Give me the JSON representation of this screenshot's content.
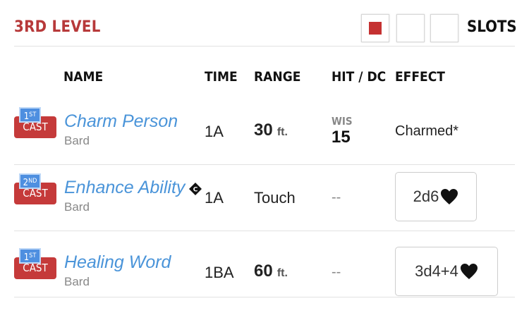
{
  "header": {
    "level_title": "3RD LEVEL",
    "slots_label": "SLOTS",
    "slot_states": [
      true,
      false,
      false
    ]
  },
  "columns": {
    "name": "NAME",
    "time": "TIME",
    "range": "RANGE",
    "hit_dc": "HIT / DC",
    "effect": "EFFECT"
  },
  "spells": [
    {
      "badge_num": "1",
      "badge_suffix": "ST",
      "cast_label": "CAST",
      "name": "Charm Person",
      "class": "Bard",
      "time": "1A",
      "range_value": "30",
      "range_unit": "ft.",
      "hit_dc_ability": "WIS",
      "hit_dc_value": "15",
      "effect": "Charmed*"
    },
    {
      "badge_num": "2",
      "badge_suffix": "ND",
      "cast_label": "CAST",
      "name": "Enhance Ability",
      "class": "Bard",
      "concentration": true,
      "time": "1A",
      "range_text": "Touch",
      "hit_dc": "--",
      "effect_heal": "2d6"
    },
    {
      "badge_num": "1",
      "badge_suffix": "ST",
      "cast_label": "CAST",
      "name": "Healing Word",
      "class": "Bard",
      "time": "1BA",
      "range_value": "60",
      "range_unit": "ft.",
      "hit_dc": "--",
      "effect_heal": "3d4+4"
    }
  ],
  "colors": {
    "accent_red": "#c53a3a",
    "link_blue": "#4a94d9",
    "badge_blue": "#4e8fe0"
  }
}
